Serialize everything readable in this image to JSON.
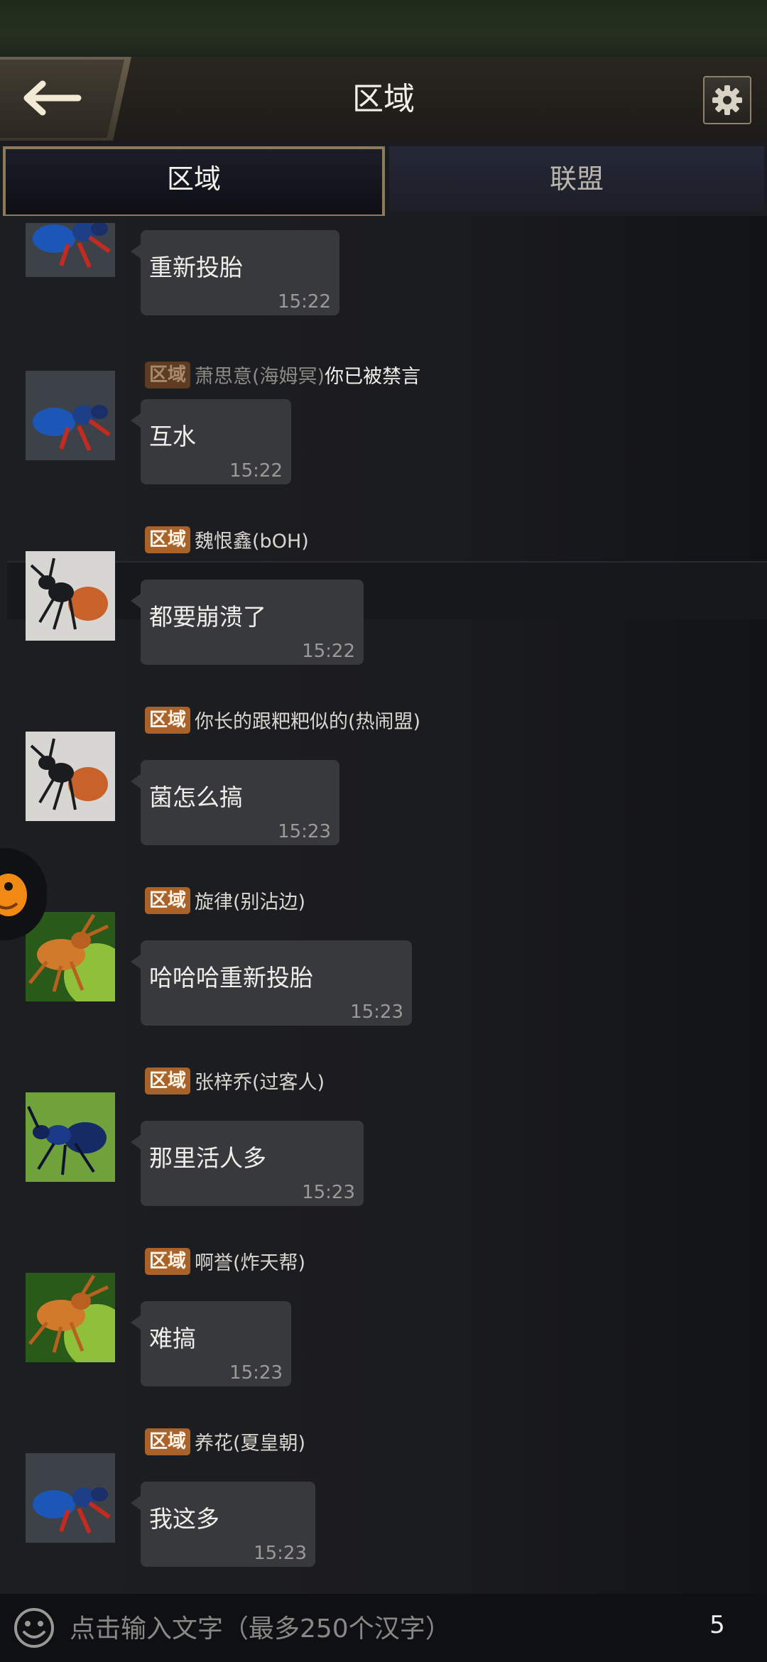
{
  "header": {
    "title": "区域"
  },
  "tabs": [
    {
      "label": "区域",
      "active": true
    },
    {
      "label": "联盟",
      "active": false
    }
  ],
  "system_notice": {
    "badge": "区域",
    "name": "萧思意(海姆冥)",
    "text": "你已被禁言"
  },
  "messages": [
    {
      "text": "重新投胎",
      "time": "15:22",
      "avatar": "blue-ant"
    },
    {
      "badge": "区域",
      "sender": "萧思意(海姆冥)",
      "text": "互水",
      "time": "15:22",
      "avatar": "blue-ant"
    },
    {
      "badge": "区域",
      "sender": "魏恨鑫(bOH)",
      "text": "都要崩溃了",
      "time": "15:22",
      "avatar": "orange-ant"
    },
    {
      "badge": "区域",
      "sender": "你长的跟粑粑似的(热闹盟)",
      "text": "菌怎么搞",
      "time": "15:23",
      "avatar": "orange-ant"
    },
    {
      "badge": "区域",
      "sender": "旋律(别沾边)",
      "text": "哈哈哈重新投胎",
      "time": "15:23",
      "avatar": "orange-beetle"
    },
    {
      "badge": "区域",
      "sender": "张梓乔(过客人)",
      "text": "那里活人多",
      "time": "15:23",
      "avatar": "dark-blue-ant"
    },
    {
      "badge": "区域",
      "sender": "啊誉(炸天帮)",
      "text": "难搞",
      "time": "15:23",
      "avatar": "orange-beetle"
    },
    {
      "badge": "区域",
      "sender": "养花(夏皇朝)",
      "text": "我这多",
      "time": "15:23",
      "avatar": "blue-ant"
    }
  ],
  "input": {
    "placeholder": "点击输入文字（最多250个汉字）",
    "char_count": "5"
  },
  "icons": {
    "back": "back-arrow-icon",
    "settings": "gear-icon",
    "emoji": "emoji-icon"
  },
  "colors": {
    "badge": "#a9622a",
    "bubble": "#38393d",
    "tab_border": "#8d7a56"
  }
}
